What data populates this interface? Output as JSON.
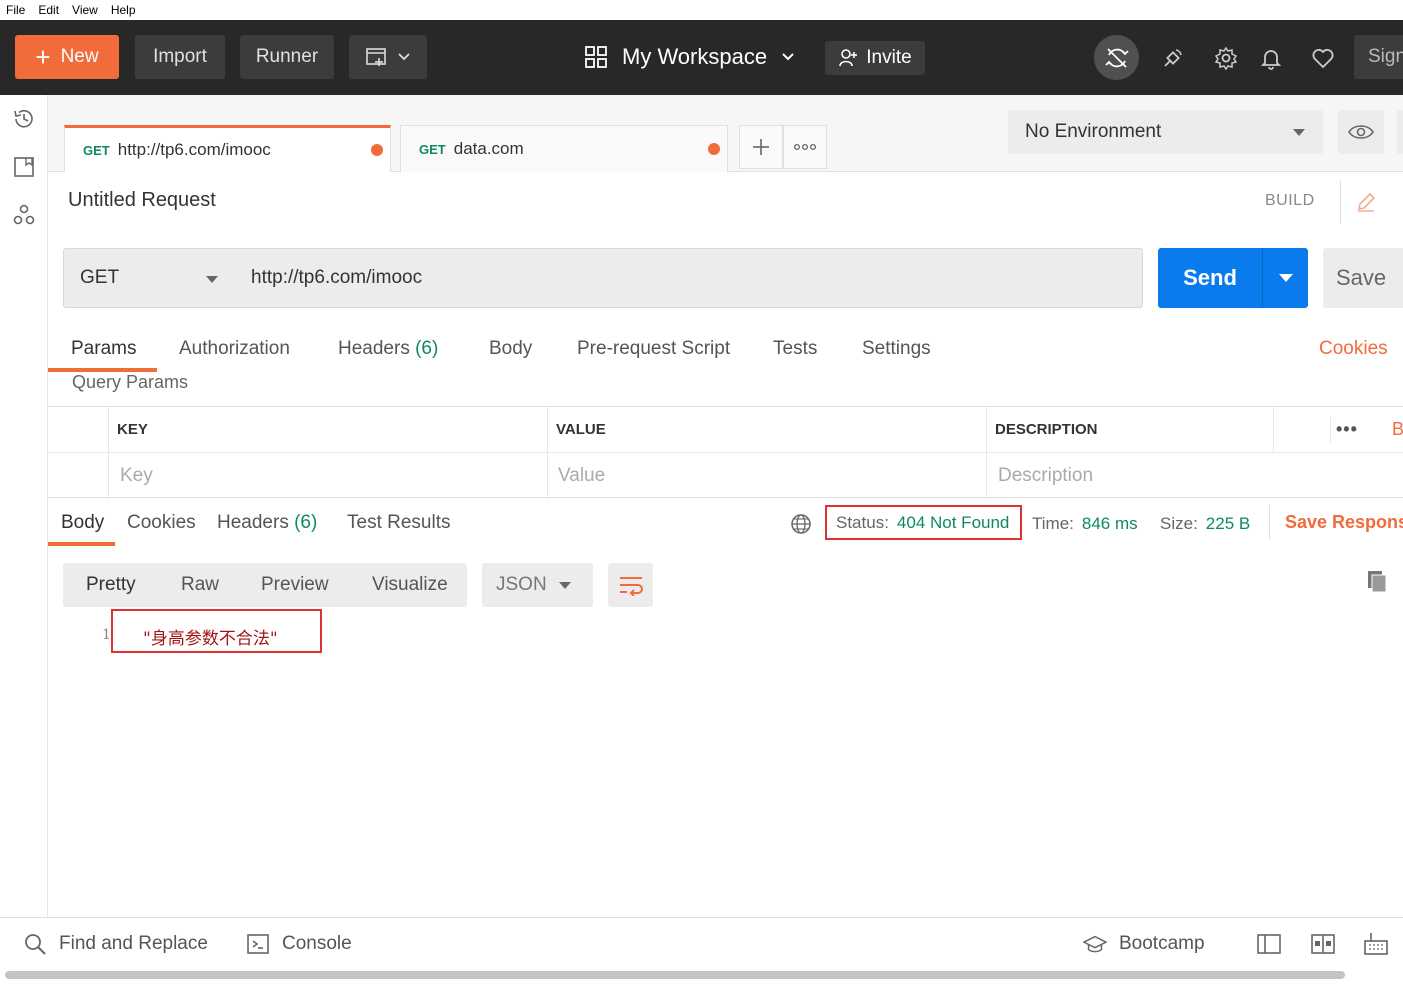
{
  "menu": [
    "File",
    "Edit",
    "View",
    "Help"
  ],
  "header": {
    "new_label": "New",
    "import_label": "Import",
    "runner_label": "Runner",
    "workspace_label": "My Workspace",
    "invite_label": "Invite",
    "signin_label": "Sign"
  },
  "tabs": [
    {
      "method": "GET",
      "title": "http://tp6.com/imooc"
    },
    {
      "method": "GET",
      "title": "data.com"
    }
  ],
  "environment": {
    "selected": "No Environment"
  },
  "request": {
    "name": "Untitled Request",
    "build_label": "BUILD",
    "method": "GET",
    "url": "http://tp6.com/imooc",
    "send_label": "Send",
    "save_label": "Save"
  },
  "request_tabs": {
    "params": "Params",
    "authorization": "Authorization",
    "headers": "Headers",
    "headers_count": "(6)",
    "body": "Body",
    "prerequest": "Pre-request Script",
    "tests": "Tests",
    "settings": "Settings",
    "cookies": "Cookies"
  },
  "query_params": {
    "title": "Query Params",
    "headers": {
      "key": "KEY",
      "value": "VALUE",
      "description": "DESCRIPTION"
    },
    "bulk_edit": "Bulk Ed",
    "placeholders": {
      "key": "Key",
      "value": "Value",
      "description": "Description"
    }
  },
  "response": {
    "tabs": {
      "body": "Body",
      "cookies": "Cookies",
      "headers": "Headers",
      "headers_count": "(6)",
      "test_results": "Test Results"
    },
    "status_label": "Status:",
    "status_value": "404 Not Found",
    "time_label": "Time:",
    "time_value": "846 ms",
    "size_label": "Size:",
    "size_value": "225 B",
    "save_response": "Save Respons",
    "view_modes": [
      "Pretty",
      "Raw",
      "Preview",
      "Visualize"
    ],
    "format": "JSON",
    "line_number": "1",
    "body_text": "\"身高参数不合法\""
  },
  "footer": {
    "find_replace": "Find and Replace",
    "console": "Console",
    "bootcamp": "Bootcamp"
  },
  "colors": {
    "accent": "#f26b3a",
    "send_blue": "#097bed",
    "status_green": "#0f8a5f",
    "highlight_red": "#e03232",
    "header_bg": "#282828"
  }
}
